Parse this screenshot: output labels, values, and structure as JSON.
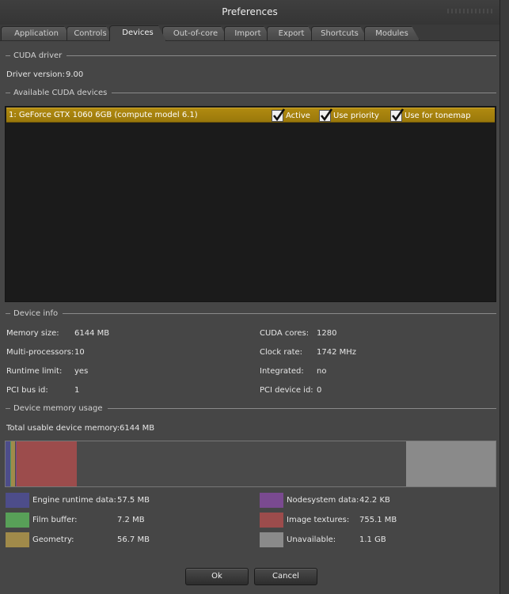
{
  "window": {
    "title": "Preferences"
  },
  "tabs": [
    {
      "label": "Application"
    },
    {
      "label": "Controls"
    },
    {
      "label": "Devices",
      "active": true
    },
    {
      "label": "Out-of-core"
    },
    {
      "label": "Import"
    },
    {
      "label": "Export"
    },
    {
      "label": "Shortcuts"
    },
    {
      "label": "Modules"
    }
  ],
  "cuda_driver": {
    "heading": "CUDA driver",
    "version_label": "Driver version:",
    "version_value": "9.00"
  },
  "devices": {
    "heading": "Available CUDA devices",
    "items": [
      {
        "name": "1: GeForce GTX 1060 6GB (compute model 6.1)",
        "active_label": "Active",
        "active": true,
        "priority_label": "Use priority",
        "priority": true,
        "tonemap_label": "Use for tonemap",
        "tonemap": true
      }
    ]
  },
  "device_info": {
    "heading": "Device info",
    "memory_size_label": "Memory size:",
    "memory_size_value": "6144 MB",
    "multiprocessors_label": "Multi-processors:",
    "multiprocessors_value": "10",
    "runtime_limit_label": "Runtime limit:",
    "runtime_limit_value": "yes",
    "pci_bus_label": "PCI bus id:",
    "pci_bus_value": "1",
    "cuda_cores_label": "CUDA cores:",
    "cuda_cores_value": "1280",
    "clock_rate_label": "Clock rate:",
    "clock_rate_value": "1742 MHz",
    "integrated_label": "Integrated:",
    "integrated_value": "no",
    "pci_device_label": "PCI device id:",
    "pci_device_value": "0"
  },
  "memory_usage": {
    "heading": "Device memory usage",
    "total_label": "Total usable device memory:",
    "total_value": "6144 MB",
    "total_mb": 6144,
    "segments": [
      {
        "key": "engine",
        "mb": 57.5,
        "color": "#4d4d8a"
      },
      {
        "key": "film",
        "mb": 7.2,
        "color": "#58a058"
      },
      {
        "key": "geometry",
        "mb": 56.7,
        "color": "#a08a4a"
      },
      {
        "key": "nodesystem",
        "mb": 0.04,
        "color": "#7a4a90"
      },
      {
        "key": "textures",
        "mb": 755.1,
        "color": "#9c4c4c"
      }
    ],
    "unavailable_mb": 1126.4,
    "unavailable_color": "#8a8a8a",
    "legend": {
      "engine_label": "Engine runtime data:",
      "engine_value": "57.5 MB",
      "engine_color": "#4d4d8a",
      "film_label": "Film buffer:",
      "film_value": "7.2 MB",
      "film_color": "#58a058",
      "geometry_label": "Geometry:",
      "geometry_value": "56.7 MB",
      "geometry_color": "#a08a4a",
      "nodesystem_label": "Nodesystem data:",
      "nodesystem_value": "42.2 KB",
      "nodesystem_color": "#7a4a90",
      "textures_label": "Image textures:",
      "textures_value": "755.1 MB",
      "textures_color": "#9c4c4c",
      "unavailable_label": "Unavailable:",
      "unavailable_value": "1.1 GB",
      "unavailable_color": "#8a8a8a"
    }
  },
  "buttons": {
    "ok_label": "Ok",
    "cancel_label": "Cancel"
  }
}
